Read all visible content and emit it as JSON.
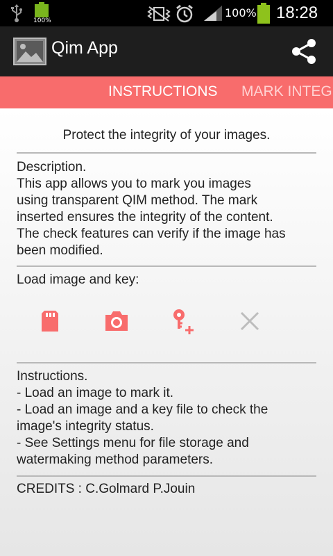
{
  "status_bar": {
    "battery_small_label": "100%",
    "battery_percent": "100%",
    "time": "18:28"
  },
  "action_bar": {
    "title": "Qim App"
  },
  "tabs": [
    {
      "label": "INSTRUCTIONS"
    },
    {
      "label": "MARK INTEG"
    }
  ],
  "main": {
    "tagline": "Protect the integrity of your images.",
    "description": "Description.\nThis app allows you to mark you images\nusing transparent QIM method. The mark\ninserted ensures the integrity of the content.\nThe check features can verify if the image has\nbeen modified.",
    "load_label": "Load image and key:",
    "instructions": "Instructions.\n- Load an image to mark it.\n- Load an image and a key file to check the\nimage's integrity status.\n- See Settings menu for file storage and\nwatermaking method parameters.",
    "credits": "CREDITS : C.Golmard P.Jouin"
  },
  "colors": {
    "accent": "#f86c6c",
    "action_bar": "#1e1e1e",
    "status_bar": "#000000"
  }
}
